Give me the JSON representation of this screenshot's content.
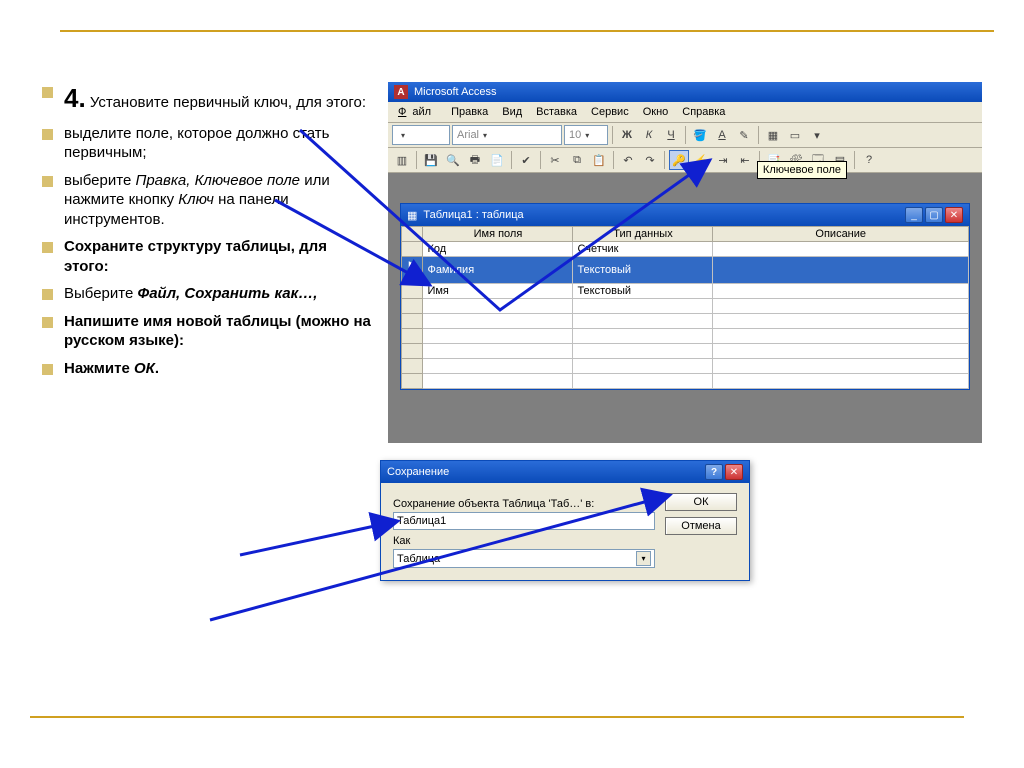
{
  "bullets": {
    "b1_num": "4.",
    "b1_text": " Установите первичный ключ, для этого:",
    "b2": "выделите поле, которое должно стать первичным;",
    "b3a": "выберите ",
    "b3b": "Правка, Ключевое поле",
    "b3c": " или нажмите кнопку ",
    "b3d": "Ключ",
    "b3e": " на панели инструментов.",
    "b4": "Сохраните структуру таблицы, для этого:",
    "b5a": "Выберите ",
    "b5b": "Файл, Сохранить как…,",
    "b6": "Напишите имя новой таблицы (можно на русском языке):",
    "b7a": "Нажмите ",
    "b7b": "ОК"
  },
  "access": {
    "title": "Microsoft Access",
    "menu": {
      "file": "Файл",
      "edit": "Правка",
      "view": "Вид",
      "insert": "Вставка",
      "service": "Сервис",
      "window": "Окно",
      "help": "Справка"
    },
    "font_name": "Arial",
    "font_size": "10",
    "tooltip": "Ключевое поле"
  },
  "child": {
    "title": "Таблица1 : таблица",
    "headers": {
      "name": "Имя поля",
      "type": "Тип данных",
      "desc": "Описание"
    },
    "rows": [
      {
        "name": "Код",
        "type": "Счетчик",
        "desc": "",
        "key": false,
        "sel": false,
        "cur": false
      },
      {
        "name": "Фамилия",
        "type": "Текстовый",
        "desc": "",
        "key": true,
        "sel": true,
        "cur": true
      },
      {
        "name": "Имя",
        "type": "Текстовый",
        "desc": "",
        "key": false,
        "sel": false,
        "cur": false
      }
    ]
  },
  "save": {
    "title": "Сохранение",
    "prompt": "Сохранение объекта Таблица 'Таб…' в:",
    "name": "Таблица1",
    "as_label": "Как",
    "as_value": "Таблица",
    "ok": "ОК",
    "cancel": "Отмена"
  }
}
